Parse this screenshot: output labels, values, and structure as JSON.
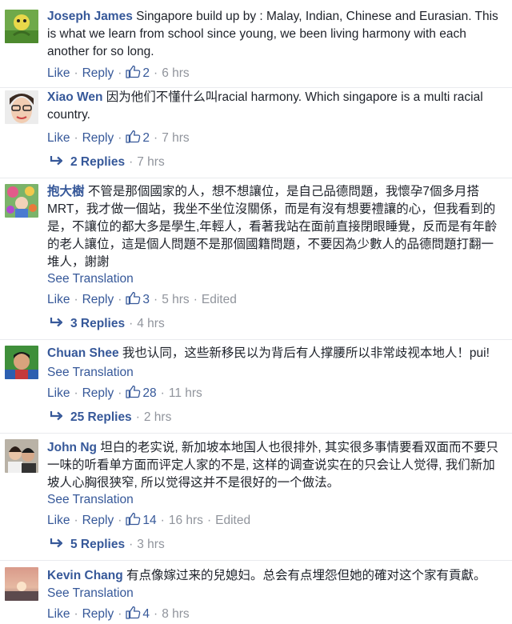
{
  "labels": {
    "like": "Like",
    "reply": "Reply",
    "see_translation": "See Translation",
    "dot": "·"
  },
  "icons": {
    "like": "thumbs-up-icon",
    "reply_arrow": "reply-arrow-icon"
  },
  "colors": {
    "link": "#365899",
    "meta": "#90949c",
    "text": "#1d2129"
  },
  "comments": [
    {
      "author": "Joseph James",
      "text": "Singapore build up by : Malay, Indian, Chinese and Eurasian. This is what we learn from school since young, we been living harmony with each another for so long.",
      "likes": "2",
      "time": "6 hrs"
    },
    {
      "author": "Xiao Wen",
      "text": "因为他们不懂什么叫racial harmony. Which singapore is a multi racial country.",
      "likes": "2",
      "time": "7 hrs",
      "replies": {
        "label": "2 Replies",
        "time": "7 hrs"
      }
    },
    {
      "author": "抱大樹",
      "text": "不管是那個國家的人，想不想讓位，是自己品德問題，我懷孕7個多月搭MRT，我才做一個站，我坐不坐位沒關係，而是有沒有想要禮讓的心，但我看到的是，不讓位的都大多是學生,年輕人，看著我站在面前直接閉眼睡覺，反而是有年齡的老人讓位，這是個人問題不是那個國籍問題，不要因為少數人的品德問題打翻一堆人，謝謝",
      "likes": "3",
      "time": "5 hrs",
      "edited": "Edited",
      "replies": {
        "label": "3 Replies",
        "time": "4 hrs"
      }
    },
    {
      "author": "Chuan Shee",
      "text": "我也认同，这些新移民以为背后有人撑腰所以非常歧视本地人！pui!",
      "likes": "28",
      "time": "11 hrs",
      "replies": {
        "label": "25 Replies",
        "time": "2 hrs"
      }
    },
    {
      "author": "John Ng",
      "text": "坦白的老实说, 新加坡本地国人也很排外, 其实很多事情要看双面而不要只一味的听看单方面而评定人家的不是, 这样的调查说实在的只会让人觉得, 我们新加坡人心胸很狭窄, 所以觉得这并不是很好的一个做法。",
      "likes": "14",
      "time": "16 hrs",
      "edited": "Edited",
      "replies": {
        "label": "5 Replies",
        "time": "3 hrs"
      }
    },
    {
      "author": "Kevin Chang",
      "text": "有点像嫁过来的兒媳妇。总会有点埋怨但她的確对这个家有貢獻。",
      "likes": "4",
      "time": "8 hrs"
    }
  ]
}
